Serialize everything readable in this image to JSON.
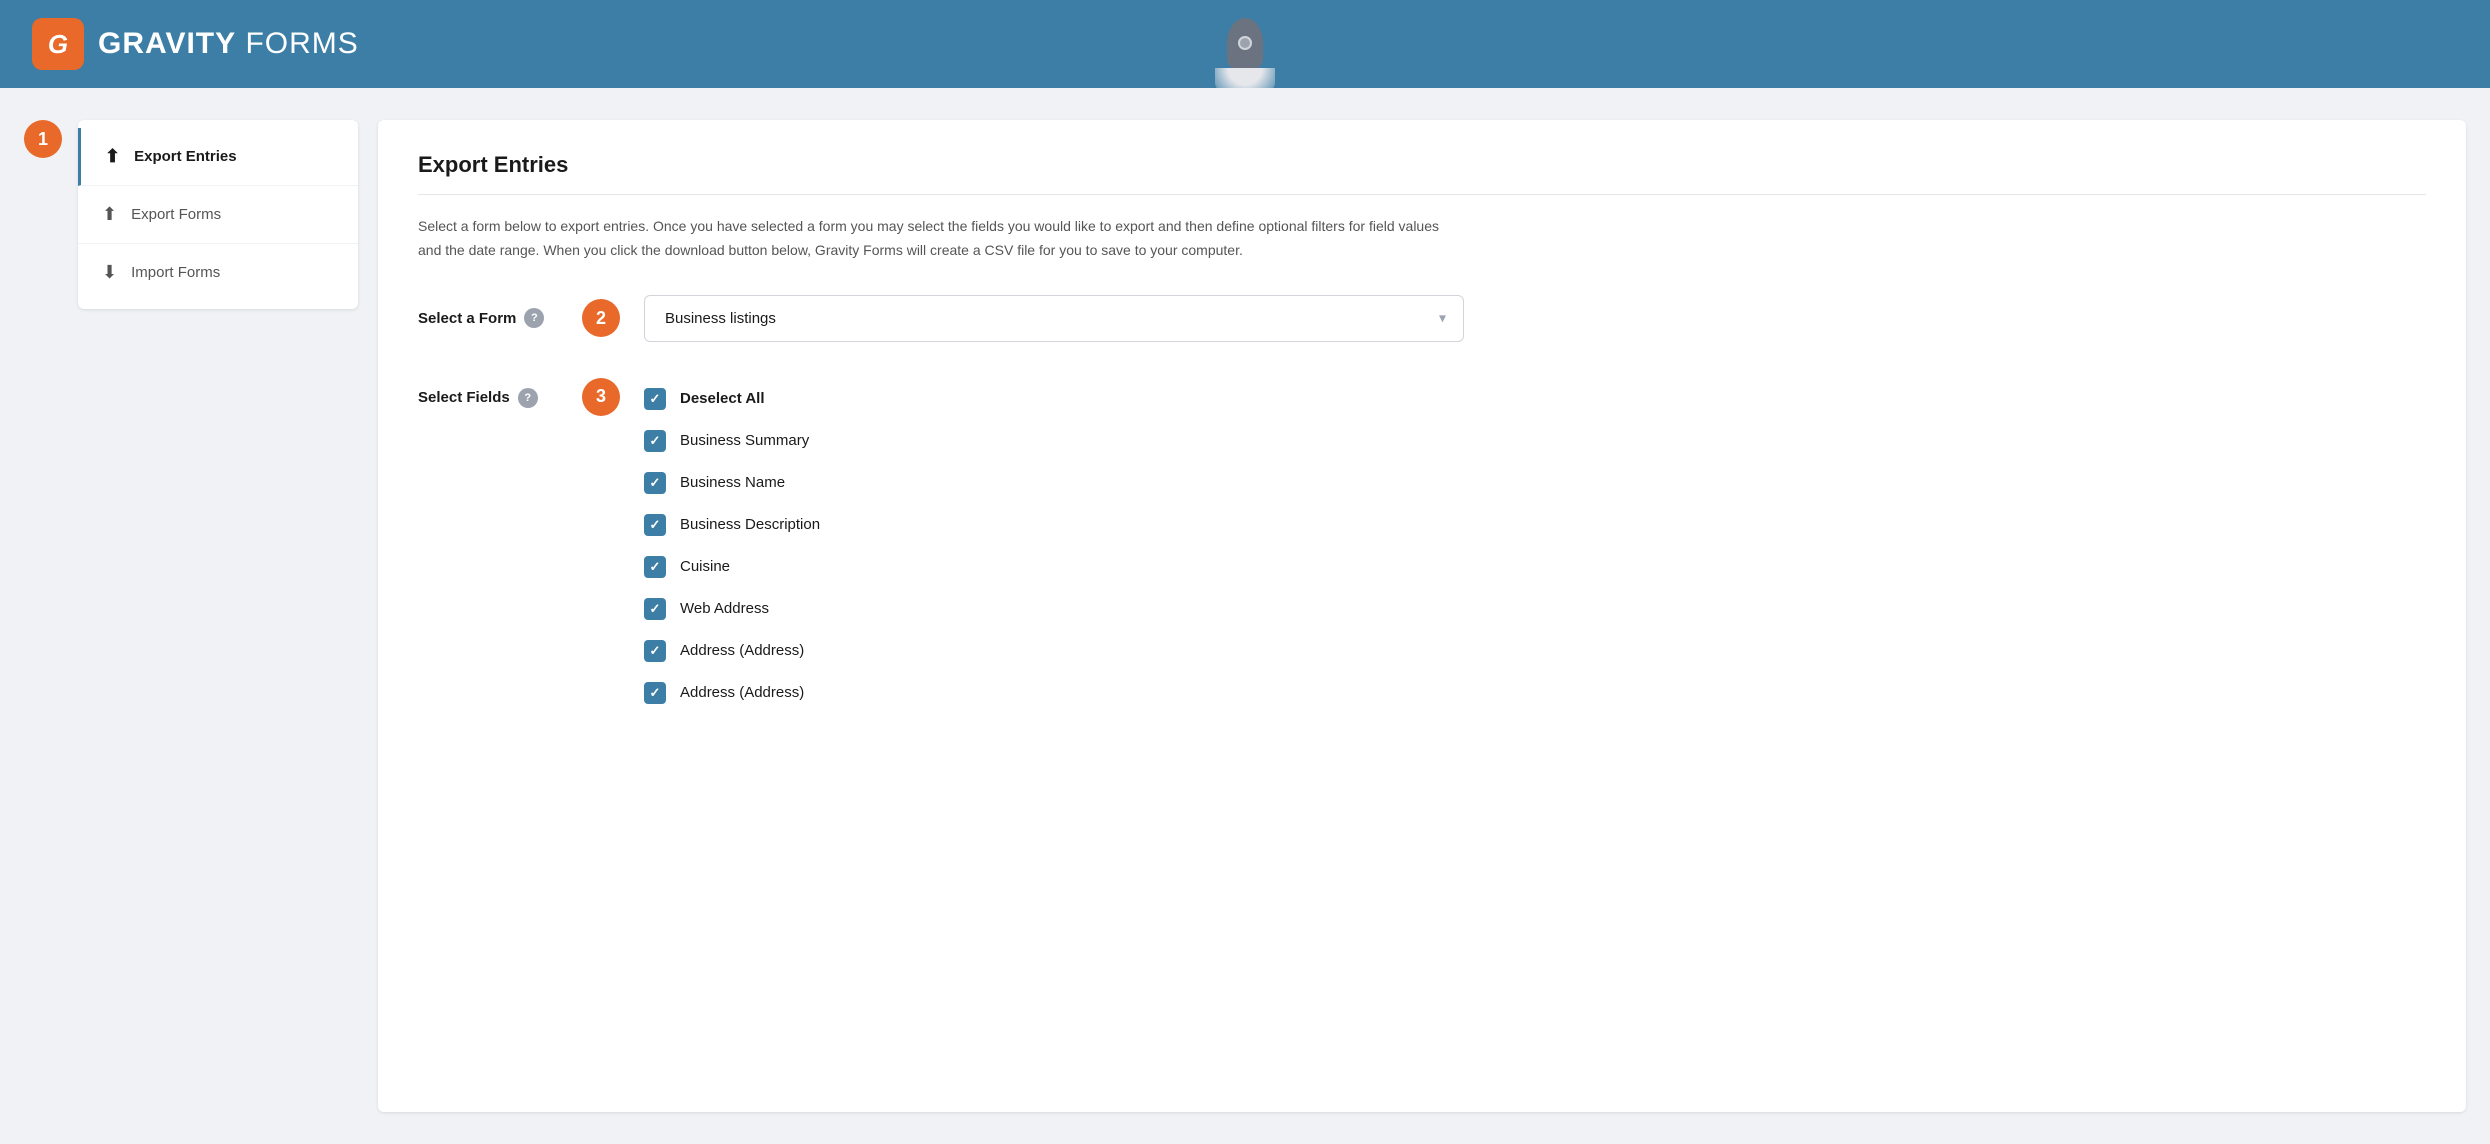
{
  "header": {
    "logo_letter": "G",
    "logo_bold": "GRAVITY",
    "logo_light": " FORMS"
  },
  "sidebar": {
    "items": [
      {
        "id": "export-entries",
        "label": "Export Entries",
        "icon": "⬆",
        "active": true
      },
      {
        "id": "export-forms",
        "label": "Export Forms",
        "icon": "⬆"
      },
      {
        "id": "import-forms",
        "label": "Import Forms",
        "icon": "⬇"
      }
    ]
  },
  "content": {
    "title": "Export Entries",
    "description": "Select a form below to export entries. Once you have selected a form you may select the fields you would like to export and then define optional filters for field values and the date range. When you click the download button below, Gravity Forms will create a CSV file for you to save to your computer.",
    "select_form_label": "Select a Form",
    "select_form_help": "?",
    "select_form_value": "Business listings",
    "select_fields_label": "Select Fields",
    "select_fields_help": "?",
    "fields": [
      {
        "label": "Deselect All",
        "checked": true,
        "bold": true
      },
      {
        "label": "Business Summary",
        "checked": true
      },
      {
        "label": "Business Name",
        "checked": true
      },
      {
        "label": "Business Description",
        "checked": true
      },
      {
        "label": "Cuisine",
        "checked": true
      },
      {
        "label": "Web Address",
        "checked": true
      },
      {
        "label": "Address (Address)",
        "checked": true
      },
      {
        "label": "Address (Address)",
        "checked": true
      }
    ]
  },
  "steps": {
    "step1": "1",
    "step2": "2",
    "step3": "3"
  }
}
